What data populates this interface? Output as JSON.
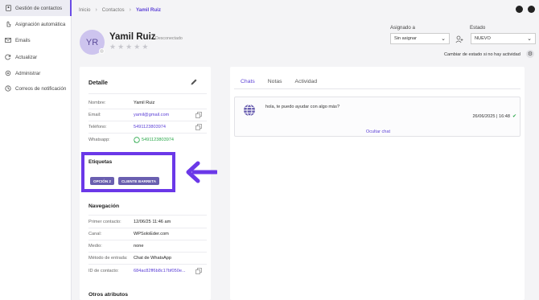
{
  "sidebar": {
    "items": [
      {
        "label": "Gestión de contactos",
        "icon": "contacts-icon",
        "active": true
      },
      {
        "label": "Asignación automática",
        "icon": "hand-icon"
      },
      {
        "label": "Emails",
        "icon": "mail-icon"
      },
      {
        "label": "Actualizar",
        "icon": "refresh-icon"
      },
      {
        "label": "Administrar",
        "icon": "settings-icon"
      },
      {
        "label": "Correos de notificación",
        "icon": "clock-icon"
      }
    ]
  },
  "breadcrumb": {
    "items": [
      "Inicio",
      "Contactos",
      "Yamil Ruiz"
    ]
  },
  "contact": {
    "initials": "YR",
    "name": "Yamil Ruiz",
    "status": "Desconectado",
    "rating": 0,
    "rating_max": 5
  },
  "assign": {
    "label": "Asignado a",
    "value": "Sin asignar"
  },
  "estado": {
    "label": "Estado",
    "value": "NUEVO",
    "auto_label": "Cambiar de estado si no hay actividad"
  },
  "detail": {
    "title": "Detalle",
    "nombre_label": "Nombre:",
    "nombre": "Yamil Ruiz",
    "email_label": "Email:",
    "email": "yamil@gmail.com",
    "telefono_label": "Teléfono:",
    "telefono": "5491123803974",
    "whatsapp_label": "Whatsapp:",
    "whatsapp": "5491123803974"
  },
  "tags": {
    "title": "Etiquetas",
    "items": [
      "OPCIÓN 2",
      "CLIENTE BARRETA"
    ]
  },
  "navigation": {
    "title": "Navegación",
    "primer_label": "Primer contacto:",
    "primer": "12/06/25 11:46 am",
    "canal_label": "Canal:",
    "canal": "WPSoloEder.com",
    "medio_label": "Medio:",
    "medio": "none",
    "metodo_label": "Método de entrada:",
    "metodo": "Chat de WhatsApp",
    "id_label": "ID de contacto:",
    "id": "684ac82ff6b8c17bf050e..."
  },
  "otros": {
    "title": "Otros atributos"
  },
  "chat_panel": {
    "tabs": [
      "Chats",
      "Notas",
      "Actividad"
    ],
    "message": "hola, te puedo ayudar con algo más?",
    "timestamp": "26/06/2025 | 16:48",
    "hide_label": "Ocultar chat"
  },
  "colors": {
    "accent": "#5b3fd6",
    "highlight": "#6b38e8",
    "whatsapp": "#2aa84a",
    "tag": "#6a5fb0"
  }
}
